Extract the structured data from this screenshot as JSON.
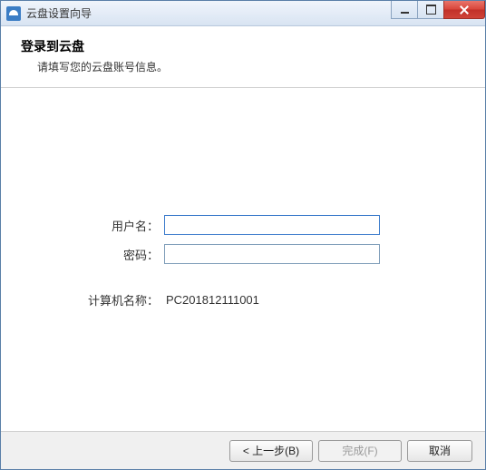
{
  "titlebar": {
    "title": "云盘设置向导"
  },
  "header": {
    "title": "登录到云盘",
    "subtitle": "请填写您的云盘账号信息。"
  },
  "form": {
    "username_label": "用户名：",
    "username_value": "",
    "password_label": "密码：",
    "password_value": "",
    "computer_label": "计算机名称：",
    "computer_value": "PC201812111001"
  },
  "footer": {
    "back_label": "< 上一步(B)",
    "finish_label": "完成(F)",
    "cancel_label": "取消"
  }
}
